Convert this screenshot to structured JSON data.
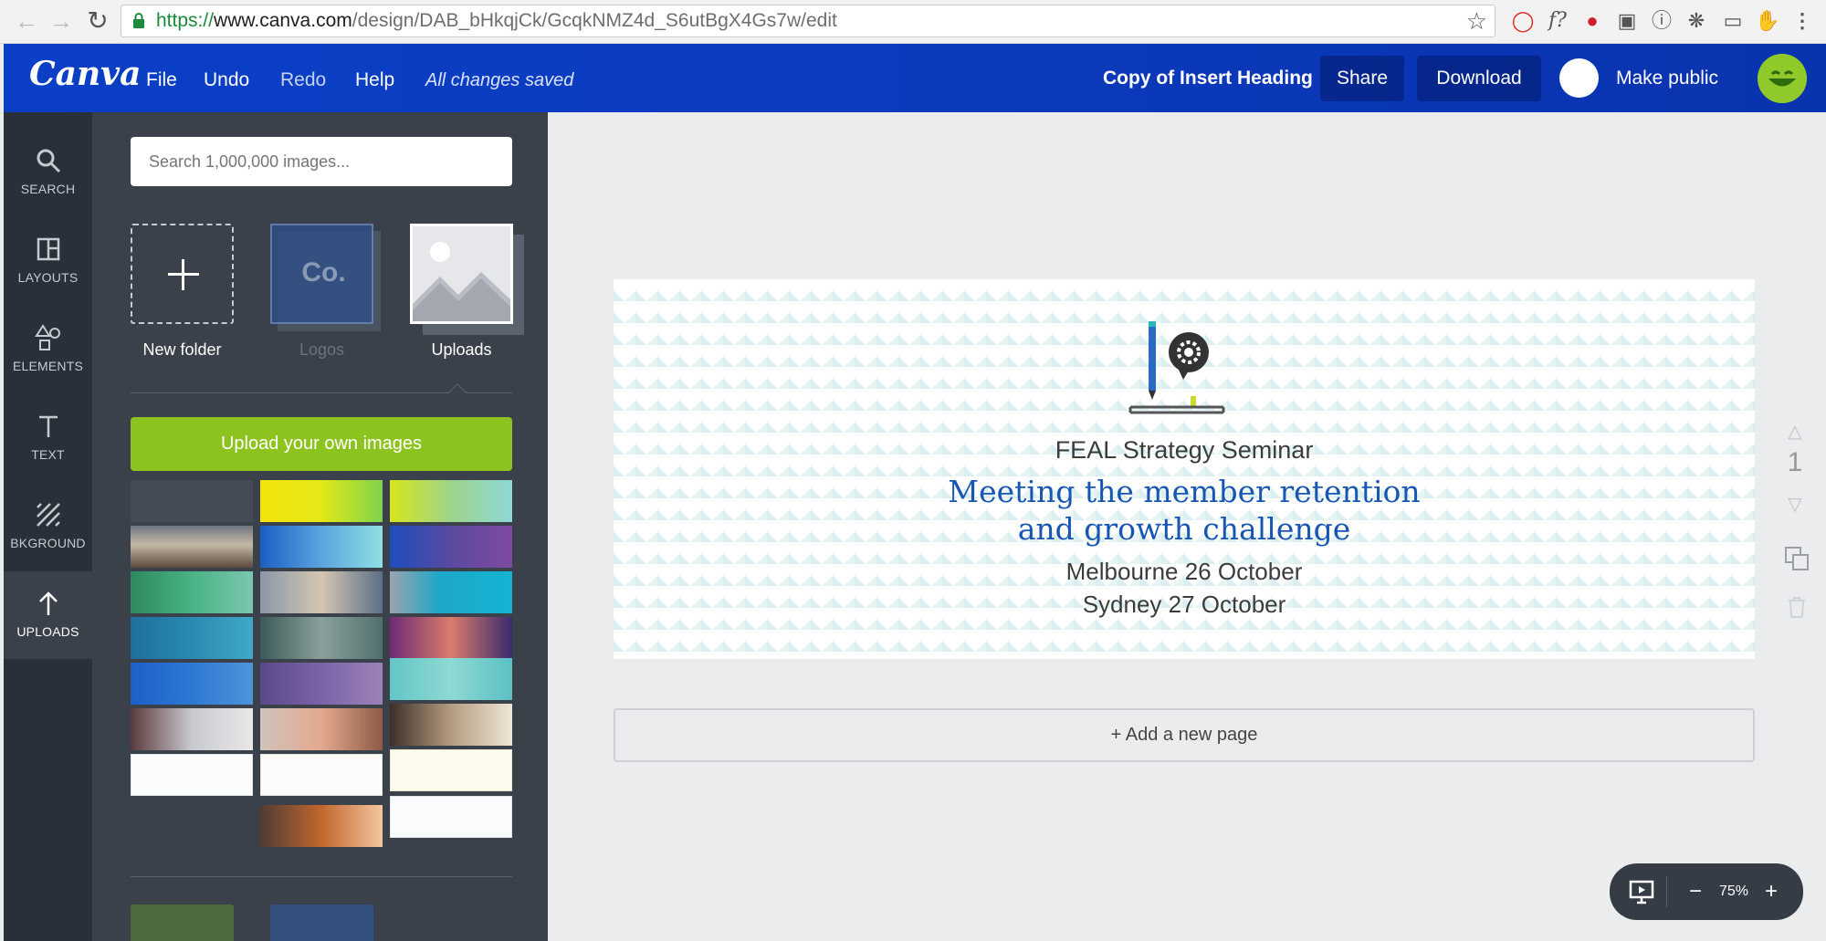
{
  "browser": {
    "url_https": "https://",
    "url_host": "www.canva.com",
    "url_path": "/design/DAB_bHkqjCk/GcqkNMZ4d_S6utBgX4Gs7w/edit"
  },
  "header": {
    "logo": "Canva",
    "menu": {
      "file": "File",
      "undo": "Undo",
      "redo": "Redo",
      "help": "Help"
    },
    "save_status": "All changes saved",
    "doc_title": "Copy of Insert Heading",
    "share": "Share",
    "download": "Download",
    "make_public": "Make public"
  },
  "rail": {
    "search": "SEARCH",
    "layouts": "LAYOUTS",
    "elements": "ELEMENTS",
    "text": "TEXT",
    "background": "BKGROUND",
    "uploads": "UPLOADS"
  },
  "panel": {
    "search_placeholder": "Search 1,000,000 images...",
    "new_folder": "New folder",
    "logos": "Logos",
    "logos_mark": "Co.",
    "uploads": "Uploads",
    "upload_button": "Upload your own images"
  },
  "design": {
    "event": "FEAL Strategy Seminar",
    "headline_line1": "Meeting the member retention",
    "headline_line2": "and growth challenge",
    "date1": "Melbourne 26 October",
    "date2": "Sydney 27 October"
  },
  "add_page": "+ Add a new page",
  "page_number": "1",
  "zoom": {
    "value": "75%",
    "minus": "−",
    "plus": "+"
  },
  "colors": {
    "brand_blue": "#0a3fc6",
    "upload_green": "#8dc31f",
    "headline_blue": "#1856b4"
  }
}
